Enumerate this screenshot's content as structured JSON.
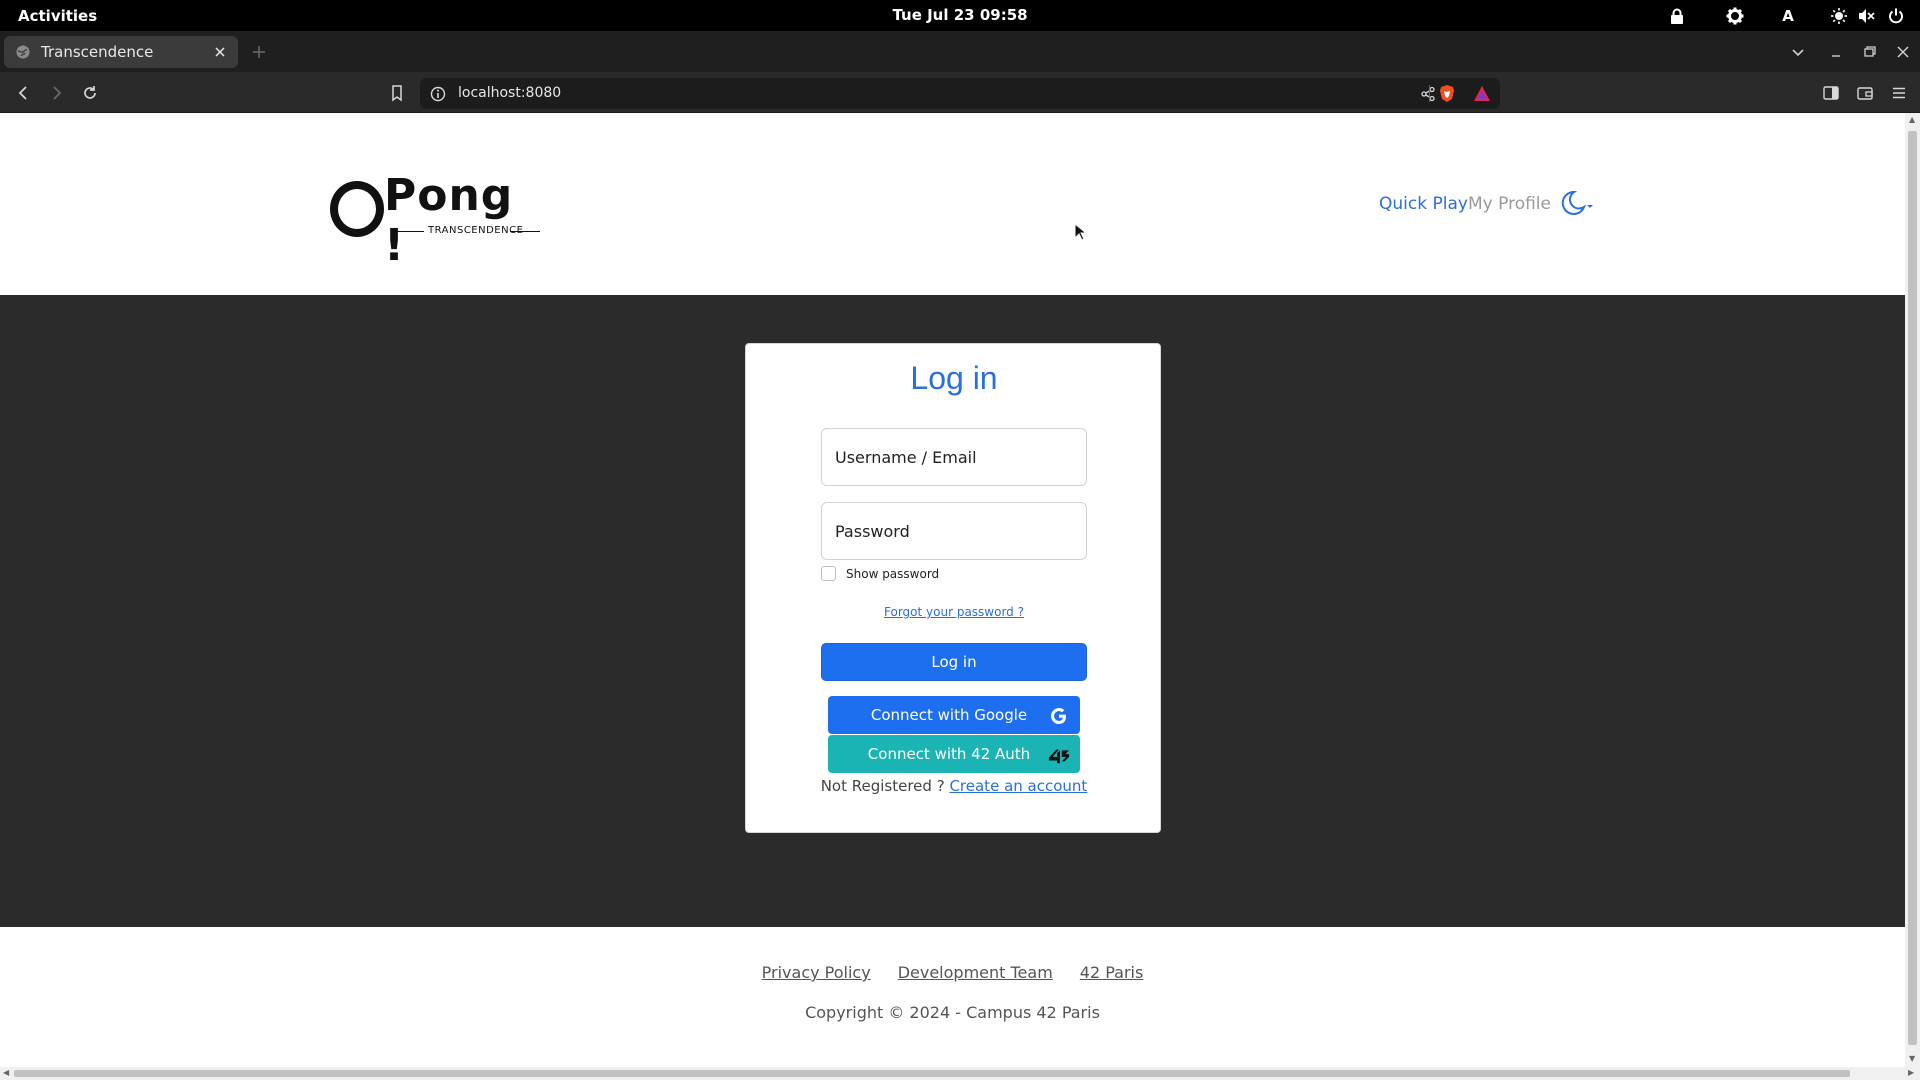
{
  "system": {
    "activities": "Activities",
    "clock": "Tue Jul 23  09:58",
    "tray_letter": "A"
  },
  "browser": {
    "tab_title": "Transcendence",
    "url": "localhost:8080"
  },
  "site": {
    "logo_title": "Pong !",
    "logo_subtitle": "TRANSCENDENCE",
    "nav": {
      "quick_play": "Quick Play",
      "my_profile": "My Profile"
    }
  },
  "login": {
    "title": "Log in",
    "username_placeholder": "Username / Email",
    "password_placeholder": "Password",
    "show_password": "Show password",
    "forgot": "Forgot your password ?",
    "submit": "Log in",
    "google": "Connect with Google",
    "auth42": "Connect with 42 Auth",
    "not_registered": "Not Registered ?",
    "create_account": "Create an account"
  },
  "footer": {
    "links": [
      "Privacy Policy",
      "Development Team",
      "42 Paris"
    ],
    "copyright": "Copyright © 2024 - Campus 42 Paris"
  },
  "colors": {
    "accent": "#1e6ff0",
    "auth42": "#1ab4b4",
    "dark_bg": "#2b2b2b"
  }
}
